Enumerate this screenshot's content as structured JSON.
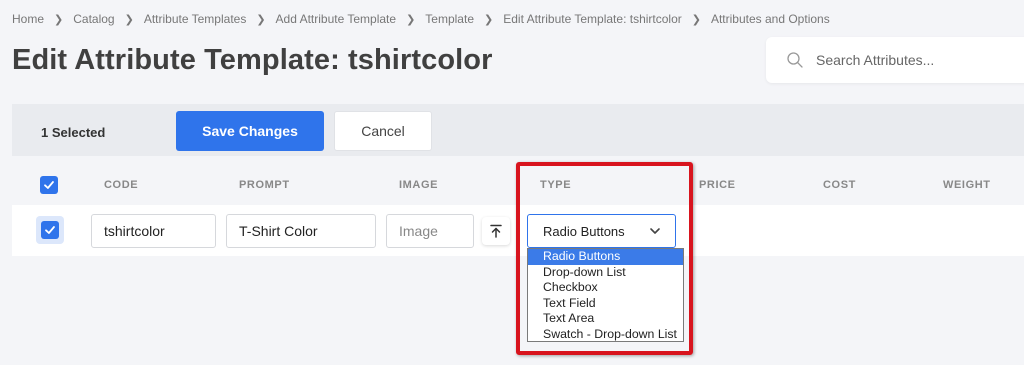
{
  "breadcrumb": [
    "Home",
    "Catalog",
    "Attribute Templates",
    "Add Attribute Template",
    "Template",
    "Edit Attribute Template: tshirtcolor",
    "Attributes and Options"
  ],
  "page_title": "Edit Attribute Template: tshirtcolor",
  "search": {
    "placeholder": "Search Attributes..."
  },
  "action_bar": {
    "selected_label": "1 Selected",
    "save_label": "Save Changes",
    "cancel_label": "Cancel"
  },
  "table": {
    "headers": {
      "code": "CODE",
      "prompt": "PROMPT",
      "image": "IMAGE",
      "type": "TYPE",
      "price": "PRICE",
      "cost": "COST",
      "weight": "WEIGHT"
    },
    "row": {
      "code": "tshirtcolor",
      "prompt": "T-Shirt Color",
      "image_placeholder": "Image",
      "type": "Radio Buttons"
    }
  },
  "type_options": [
    "Radio Buttons",
    "Drop-down List",
    "Checkbox",
    "Text Field",
    "Text Area",
    "Swatch - Drop-down List"
  ],
  "colors": {
    "primary": "#2f74eb",
    "highlight": "#d8141e",
    "dropdown_selected": "#3b7be8"
  },
  "icons": [
    "search-icon",
    "check-icon",
    "upload-icon",
    "chevron-down-icon"
  ]
}
